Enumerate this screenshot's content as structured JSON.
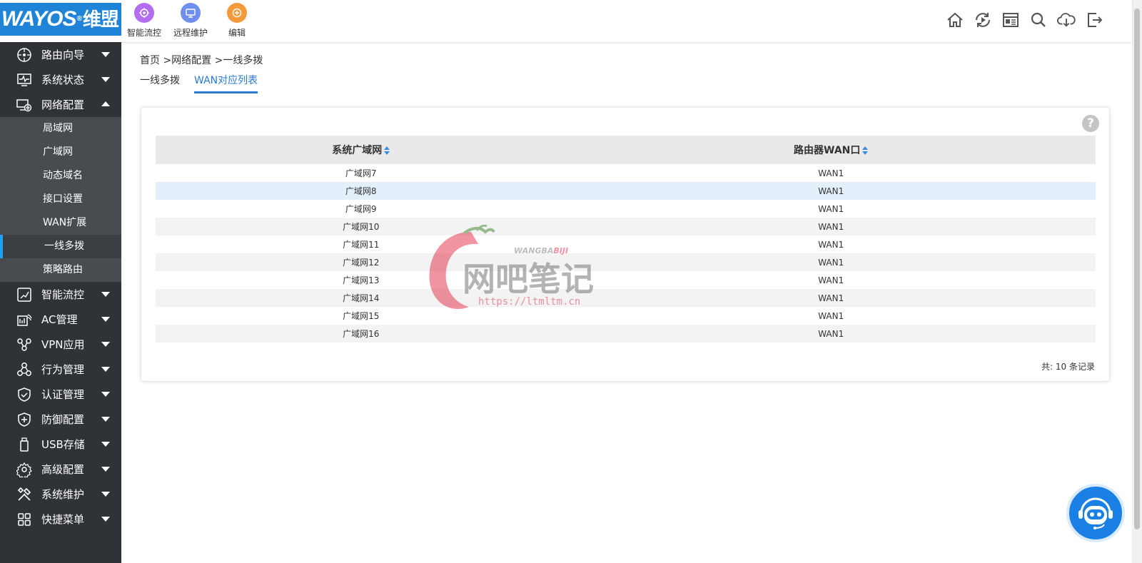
{
  "header": {
    "logo_text": "WAYOS",
    "logo_cn": "维盟",
    "logo_reg": "®",
    "quick_buttons": [
      {
        "label": "智能流控",
        "color": "#b46cf0",
        "icon": "flow-control-icon"
      },
      {
        "label": "远程维护",
        "color": "#6f8ff0",
        "icon": "remote-maintain-icon"
      },
      {
        "label": "编辑",
        "color": "#f59a3b",
        "icon": "edit-icon"
      }
    ],
    "icons": [
      "home-icon",
      "refresh-play-icon",
      "news-icon",
      "search-icon",
      "download-cloud-icon",
      "logout-icon"
    ]
  },
  "sidebar": {
    "items": [
      {
        "label": "路由向导",
        "icon": "route-wizard-icon"
      },
      {
        "label": "系统状态",
        "icon": "system-status-icon"
      },
      {
        "label": "网络配置",
        "icon": "network-config-icon"
      },
      {
        "label": "智能流控",
        "icon": "flow-control-icon"
      },
      {
        "label": "AC管理",
        "icon": "ac-manage-icon"
      },
      {
        "label": "VPN应用",
        "icon": "vpn-icon"
      },
      {
        "label": "行为管理",
        "icon": "behavior-icon"
      },
      {
        "label": "认证管理",
        "icon": "auth-shield-icon"
      },
      {
        "label": "防御配置",
        "icon": "defense-shield-icon"
      },
      {
        "label": "USB存储",
        "icon": "usb-icon"
      },
      {
        "label": "高级配置",
        "icon": "gear-icon"
      },
      {
        "label": "系统维护",
        "icon": "tools-icon"
      },
      {
        "label": "快捷菜单",
        "icon": "grid-icon"
      }
    ],
    "submenu": [
      "局域网",
      "广域网",
      "动态域名",
      "接口设置",
      "WAN扩展",
      "一线多拨",
      "策略路由"
    ],
    "active_sub": "一线多拨"
  },
  "main": {
    "breadcrumb": "首页 >网络配置 >一线多拨",
    "tabs": [
      {
        "label": "一线多拨",
        "active": false
      },
      {
        "label": "WAN对应列表",
        "active": true
      }
    ],
    "help": "?",
    "table": {
      "columns": [
        "系统广域网",
        "路由器WAN口"
      ],
      "rows": [
        [
          "广域网7",
          "WAN1"
        ],
        [
          "广域网8",
          "WAN1"
        ],
        [
          "广域网9",
          "WAN1"
        ],
        [
          "广域网10",
          "WAN1"
        ],
        [
          "广域网11",
          "WAN1"
        ],
        [
          "广域网12",
          "WAN1"
        ],
        [
          "广域网13",
          "WAN1"
        ],
        [
          "广域网14",
          "WAN1"
        ],
        [
          "广域网15",
          "WAN1"
        ],
        [
          "广域网16",
          "WAN1"
        ]
      ],
      "hover_row": 1
    },
    "records": "共: 10 条记录"
  },
  "watermark": {
    "small": "WANGBA",
    "small_accent": "BIJI",
    "big": "网吧笔记",
    "url": "https://ltmltm.cn"
  }
}
